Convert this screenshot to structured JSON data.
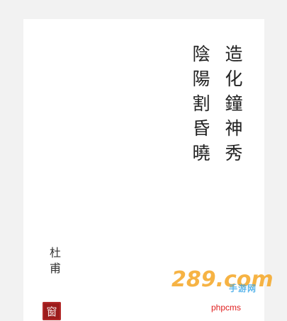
{
  "poem": {
    "lines": [
      "造化鐘神秀",
      "陰陽割昏曉"
    ]
  },
  "author": "杜甫",
  "seal_text": "窗",
  "watermark": {
    "logo_text": "289.com",
    "sub_text": "手游网"
  },
  "footer": "phpcms",
  "colors": {
    "background": "#f2f2f2",
    "page": "#ffffff",
    "text": "#222222",
    "seal": "#9c1c1c",
    "watermark_orange": "#f5a623",
    "watermark_blue": "#3fa9e8",
    "footer": "#e02020"
  }
}
